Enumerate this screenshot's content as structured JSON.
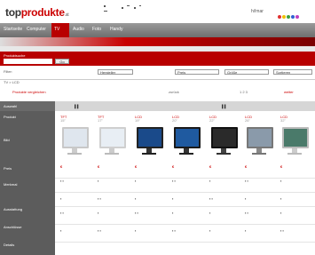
{
  "header": {
    "logo_main": "top",
    "logo_accent": "produkte",
    "logo_tld": ".at",
    "right_text": "hi!mar"
  },
  "colors": {
    "brand_red": "#cc0000",
    "nav_gray": "#7a7a7a",
    "dots": [
      "#e03030",
      "#f0c000",
      "#40a040",
      "#3060d0",
      "#c040c0"
    ]
  },
  "nav": {
    "items": [
      "Startseite",
      "Computer",
      "TV",
      "Audio",
      "Foto",
      "Handy"
    ]
  },
  "search": {
    "label": "Produktsuche",
    "input_value": "",
    "button": "Go"
  },
  "filter": {
    "text": "Filter:",
    "selects": [
      "Hersteller",
      "Preis",
      "Größe",
      "Sortieren"
    ]
  },
  "breadcrumb": "TV > LCD",
  "actions": {
    "compare": "Produkte vergleichen",
    "left": "zurück",
    "right": "weiter",
    "page": "1 2 3"
  },
  "table": {
    "selected": "Auswahl",
    "headers": [
      "",
      "",
      "",
      "",
      "",
      "",
      ""
    ],
    "labels": [
      "Produkt",
      "Bild",
      "Preis",
      "Merkmal",
      "Ausstattung",
      "Anschlüsse",
      "Details"
    ],
    "products": [
      {
        "name": "TFT",
        "sub": "15\"",
        "price": "€"
      },
      {
        "name": "TFT",
        "sub": "17\"",
        "price": "€"
      },
      {
        "name": "LCD",
        "sub": "19\"",
        "price": "€"
      },
      {
        "name": "LCD",
        "sub": "20\"",
        "price": "€"
      },
      {
        "name": "LCD",
        "sub": "22\"",
        "price": "€"
      },
      {
        "name": "LCD",
        "sub": "26\"",
        "price": "€"
      },
      {
        "name": "LCD",
        "sub": "32\"",
        "price": "€"
      }
    ]
  }
}
